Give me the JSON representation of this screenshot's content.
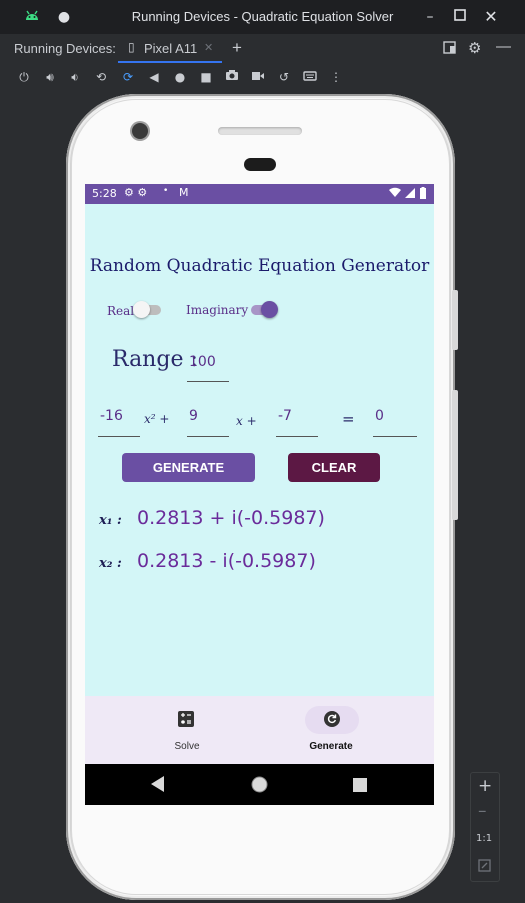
{
  "window": {
    "title": "Running Devices - Quadratic Equation Solver"
  },
  "tabbar": {
    "label": "Running Devices:",
    "tab": "Pixel A11"
  },
  "device": {
    "status_time": "5:28"
  },
  "app": {
    "title": "Random Quadratic Equation Generator",
    "real_label": "Real",
    "imaginary_label": "Imaginary",
    "real_on": false,
    "imaginary_on": true,
    "range_label": "Range :",
    "range_value": "100",
    "coef_a": "-16",
    "x2_term": "x² +",
    "coef_b": "9",
    "x_term": "x +",
    "coef_c": "-7",
    "equals": "=",
    "rhs": "0",
    "generate_label": "GENERATE",
    "clear_label": "CLEAR",
    "root1_label": "x₁ :",
    "root1_value": "0.2813 + i(-0.5987)",
    "root2_label": "x₂ :",
    "root2_value": "0.2813 - i(-0.5987)"
  },
  "bottom_nav": {
    "solve_label": "Solve",
    "generate_label": "Generate"
  },
  "zoom": {
    "ratio_label": "1:1"
  },
  "colors": {
    "status_bar": "#6a4fa3",
    "screen_bg": "#d3f6f7",
    "generate_button": "#6a4fa3",
    "clear_button": "#5c1844",
    "root_text": "#6a2b9a"
  },
  "icons": [
    "android-icon",
    "dot-icon",
    "minimize-icon",
    "maximize-icon",
    "close-icon",
    "device-icon",
    "add-tab-icon",
    "layout-icon",
    "settings-icon",
    "hide-icon",
    "power-icon",
    "volume-up-icon",
    "volume-down-icon",
    "rotate-left-icon",
    "rotate-right-icon",
    "back-icon",
    "home-icon",
    "overview-icon",
    "screenshot-icon",
    "record-icon",
    "reset-icon",
    "keyboard-icon",
    "more-icon",
    "calculator-icon",
    "refresh-icon",
    "zoom-in-icon",
    "zoom-out-icon",
    "fit-icon"
  ]
}
